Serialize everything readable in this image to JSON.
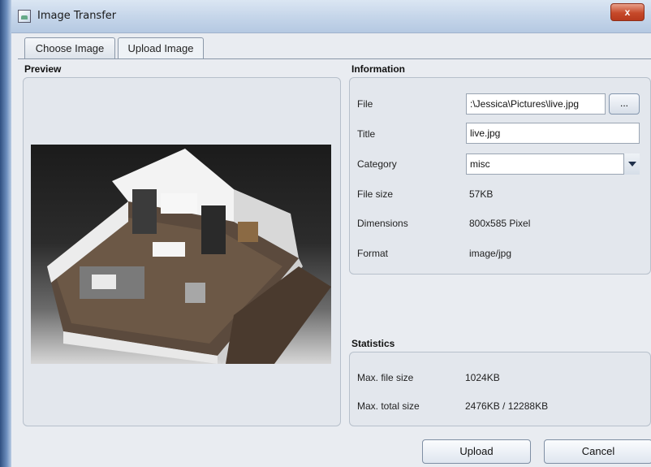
{
  "window": {
    "title": "Image Transfer",
    "close_label": "x"
  },
  "tabs": [
    {
      "label": "Choose Image",
      "active": false
    },
    {
      "label": "Upload Image",
      "active": true
    }
  ],
  "preview": {
    "title": "Preview"
  },
  "information": {
    "title": "Information",
    "file_label": "File",
    "file_value": ":\\Jessica\\Pictures\\live.jpg",
    "browse_label": "...",
    "title_label": "Title",
    "title_value": "live.jpg",
    "category_label": "Category",
    "category_value": "misc",
    "filesize_label": "File size",
    "filesize_value": "57KB",
    "dimensions_label": "Dimensions",
    "dimensions_value": "800x585 Pixel",
    "format_label": "Format",
    "format_value": "image/jpg"
  },
  "statistics": {
    "title": "Statistics",
    "maxfile_label": "Max. file size",
    "maxfile_value": "1024KB",
    "maxtotal_label": "Max. total size",
    "maxtotal_value": "2476KB / 12288KB"
  },
  "actions": {
    "upload_label": "Upload",
    "cancel_label": "Cancel"
  },
  "colors": {
    "window_bg": "#e9ecf1",
    "titlebar": "#c6d6ea",
    "close": "#c6492a"
  }
}
